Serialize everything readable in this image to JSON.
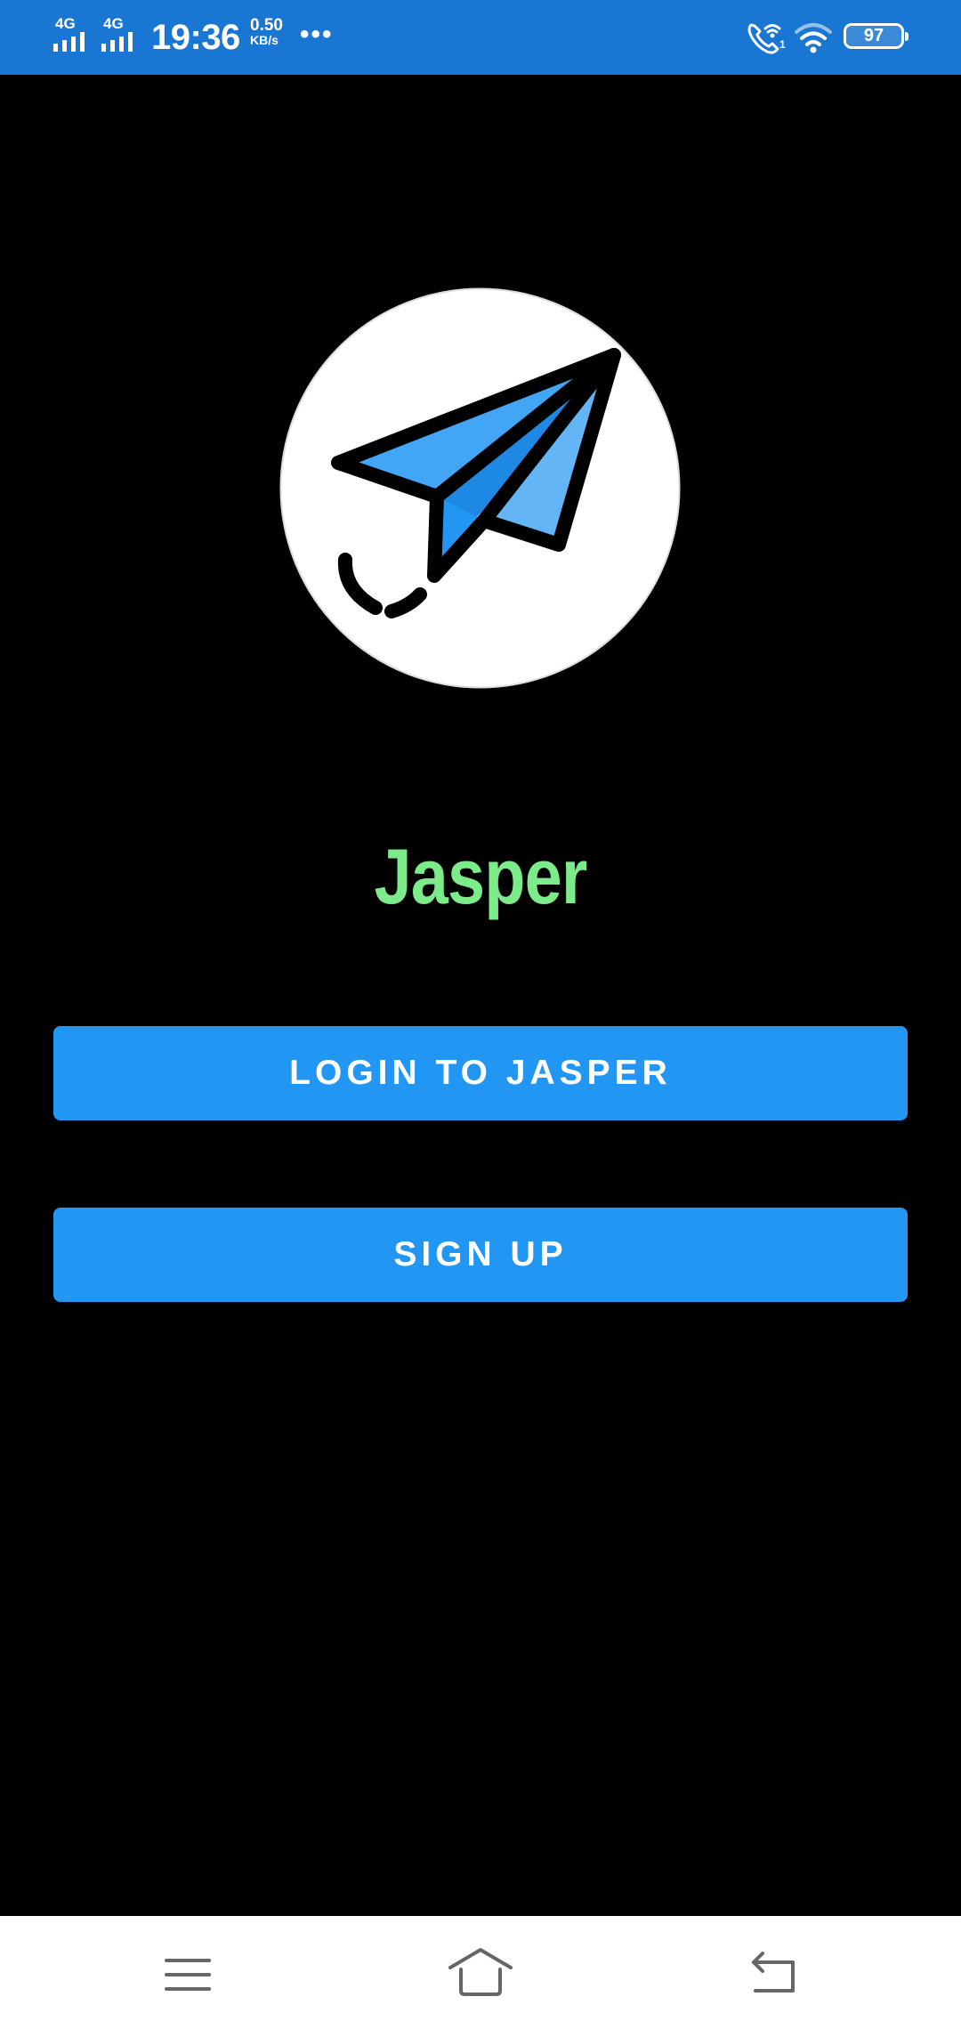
{
  "status_bar": {
    "sim1_network": "4G",
    "sim2_network": "4G",
    "time": "19:36",
    "net_speed_value": "0.50",
    "net_speed_unit": "KB/s",
    "more_indicator": "•••",
    "battery_level": "97",
    "icons": [
      "signal-icon",
      "signal-icon",
      "wifi-calling-icon",
      "wifi-icon",
      "battery-icon"
    ],
    "background_color": "#1976D2"
  },
  "main": {
    "logo_icon": "paper-plane-icon",
    "app_title": "Jasper",
    "title_color": "#7CEB8A",
    "login_button_label": "LOGIN TO JASPER",
    "signup_button_label": "SIGN UP",
    "button_color": "#2196F3",
    "background_color": "#000000"
  },
  "nav_bar": {
    "items": [
      "menu-icon",
      "home-icon",
      "back-icon"
    ]
  }
}
